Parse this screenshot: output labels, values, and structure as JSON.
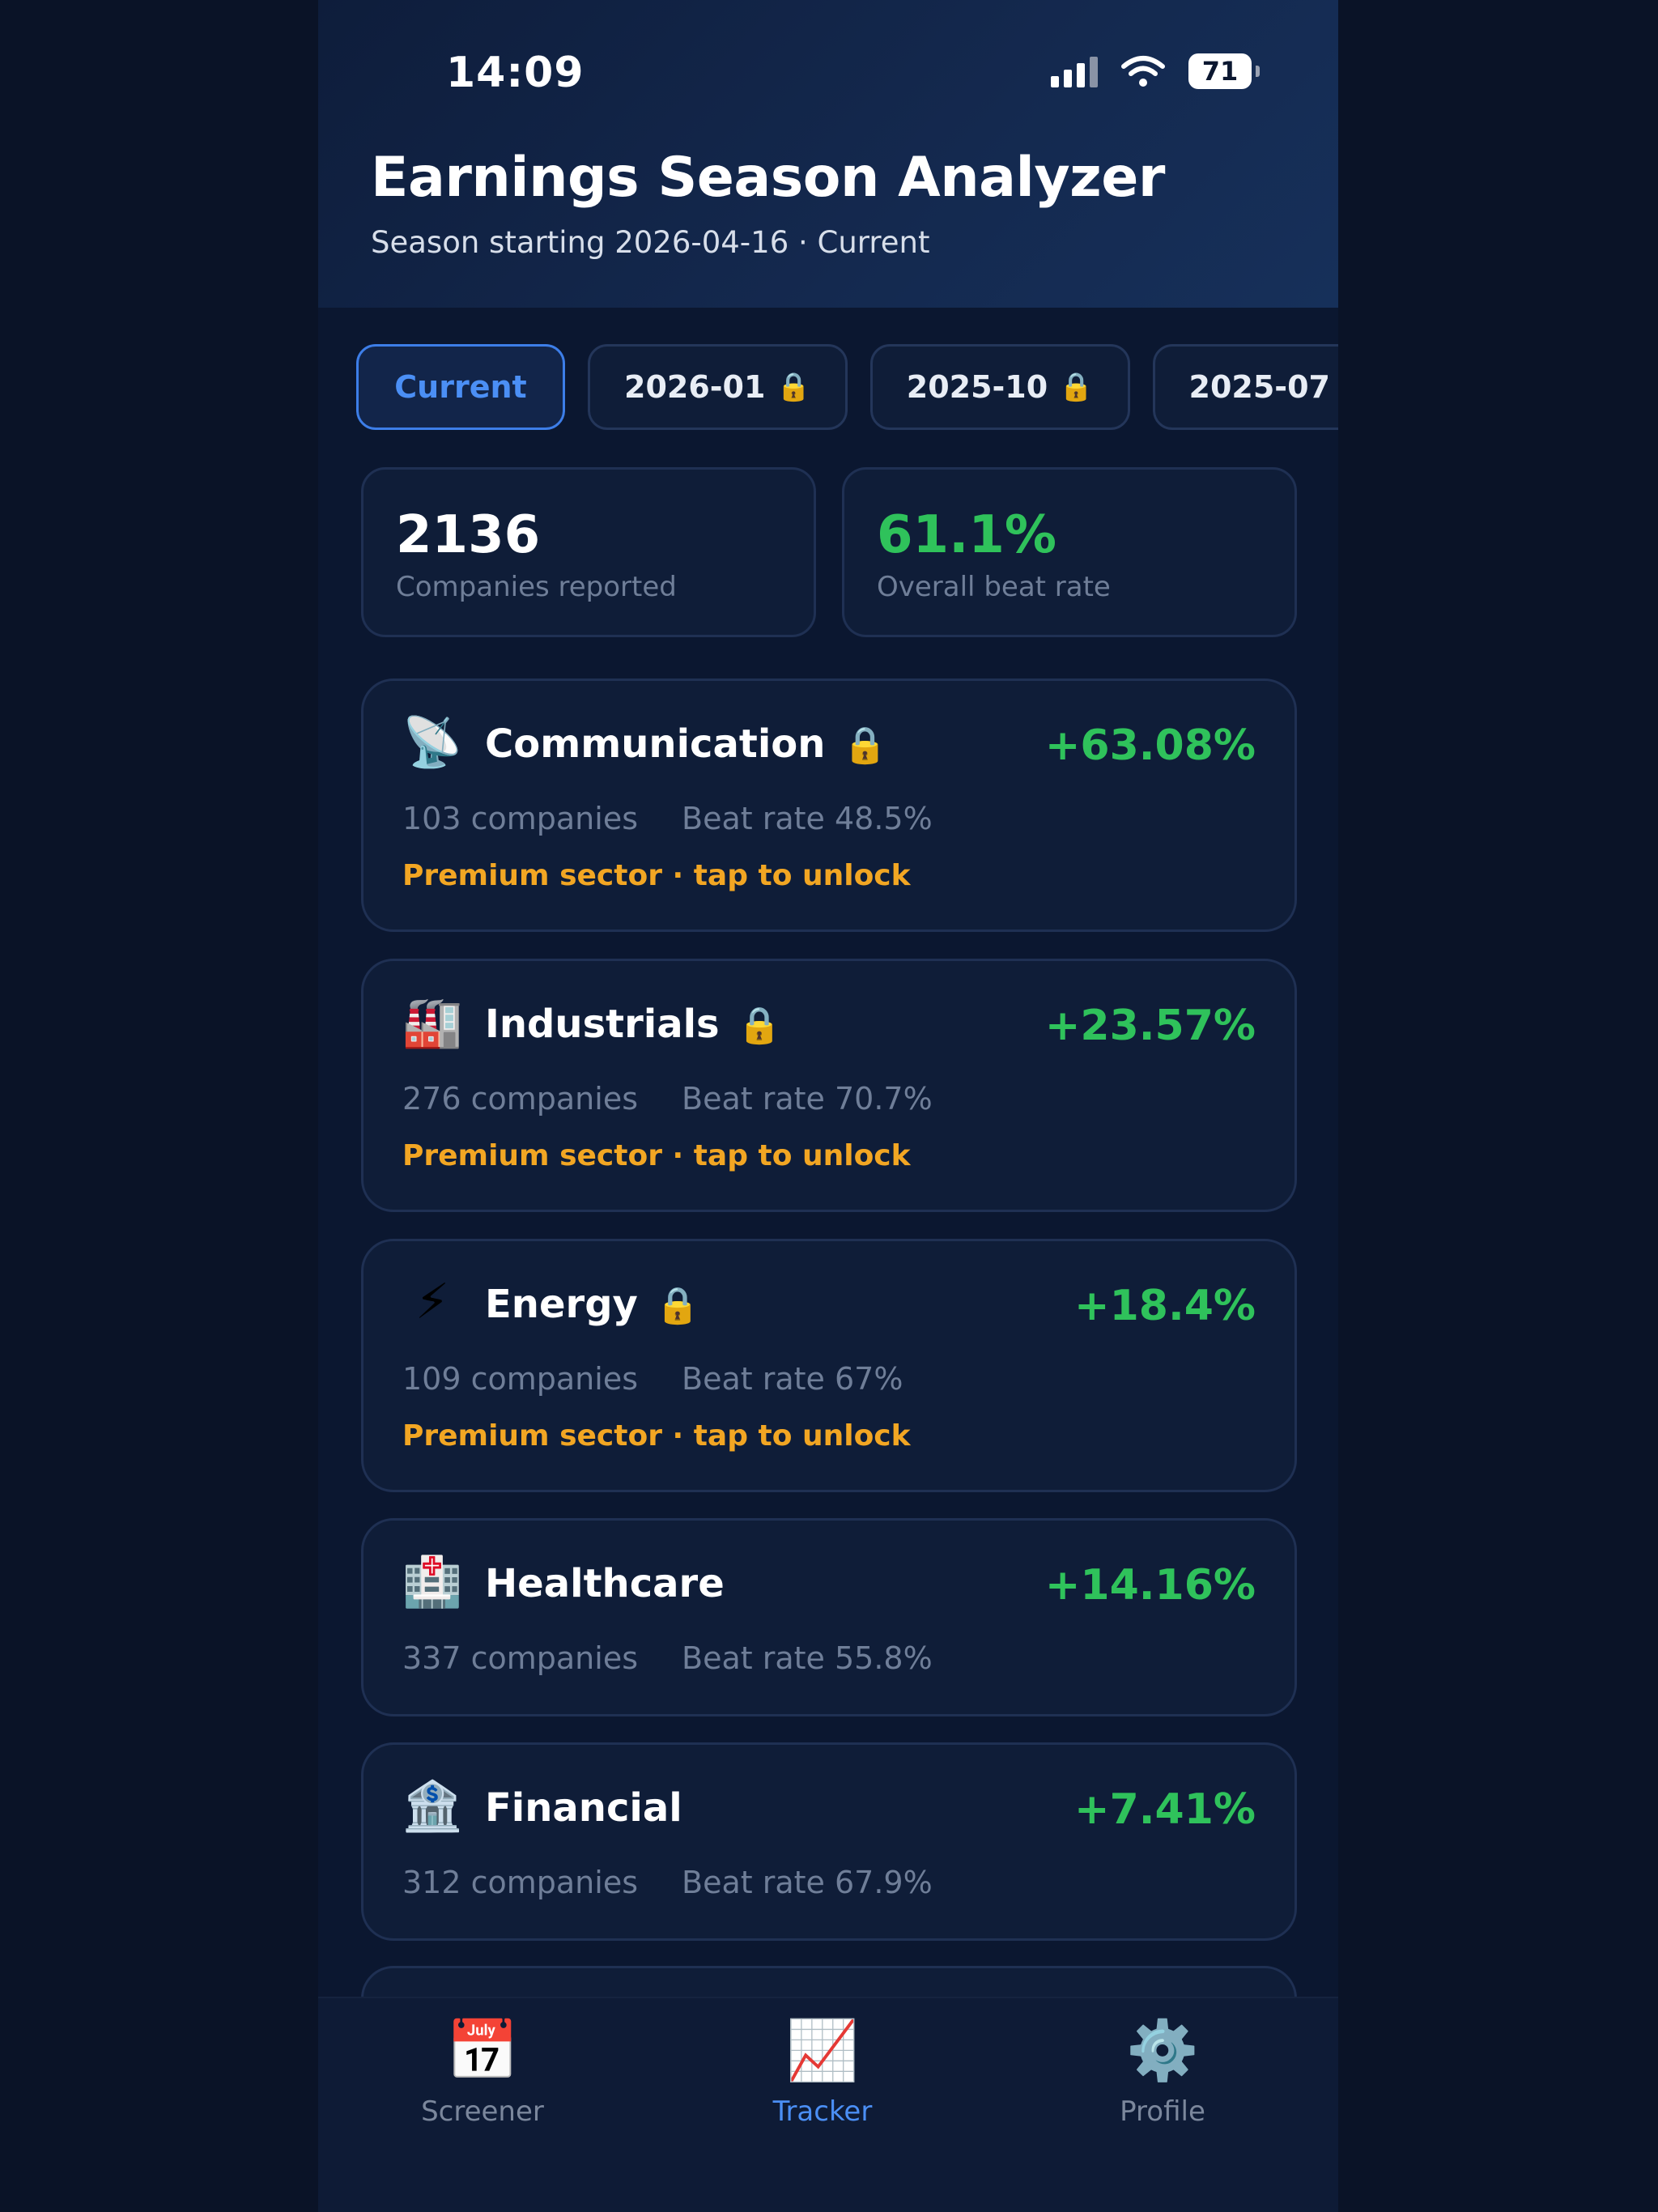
{
  "status_bar": {
    "time": "14:09",
    "battery": "71"
  },
  "header": {
    "title": "Earnings Season Analyzer",
    "subtitle": "Season starting 2026-04-16 · Current"
  },
  "tabs": [
    {
      "label": "Current",
      "locked": false,
      "active": true
    },
    {
      "label": "2026-01",
      "locked": true
    },
    {
      "label": "2025-10",
      "locked": true
    },
    {
      "label": "2025-07",
      "locked": true
    }
  ],
  "lock_icon": "🔒",
  "stats": {
    "companies": {
      "value": "2136",
      "label": "Companies reported"
    },
    "beat_rate": {
      "value": "61.1%",
      "label": "Overall beat rate"
    }
  },
  "sectors": [
    {
      "icon": "📡",
      "name": "Communication",
      "locked": true,
      "change": "+63.08%",
      "companies": "103 companies",
      "beat_rate": "Beat rate 48.5%",
      "premium": "Premium sector · tap to unlock"
    },
    {
      "icon": "🏭",
      "name": "Industrials",
      "locked": true,
      "change": "+23.57%",
      "companies": "276 companies",
      "beat_rate": "Beat rate 70.7%",
      "premium": "Premium sector · tap to unlock"
    },
    {
      "icon": "⚡",
      "name": "Energy",
      "locked": true,
      "change": "+18.4%",
      "companies": "109 companies",
      "beat_rate": "Beat rate 67%",
      "premium": "Premium sector · tap to unlock"
    },
    {
      "icon": "🏥",
      "name": "Healthcare",
      "locked": false,
      "change": "+14.16%",
      "companies": "337 companies",
      "beat_rate": "Beat rate 55.8%"
    },
    {
      "icon": "🏦",
      "name": "Financial",
      "locked": false,
      "change": "+7.41%",
      "companies": "312 companies",
      "beat_rate": "Beat rate 67.9%"
    }
  ],
  "nav": [
    {
      "icon": "📅",
      "label": "Screener",
      "active": false
    },
    {
      "icon": "📈",
      "label": "Tracker",
      "active": true
    },
    {
      "icon": "⚙️",
      "label": "Profile",
      "active": false
    }
  ],
  "colors": {
    "accent": "#4b8ff5",
    "positive": "#2fc25b",
    "premium": "#f2a623"
  }
}
